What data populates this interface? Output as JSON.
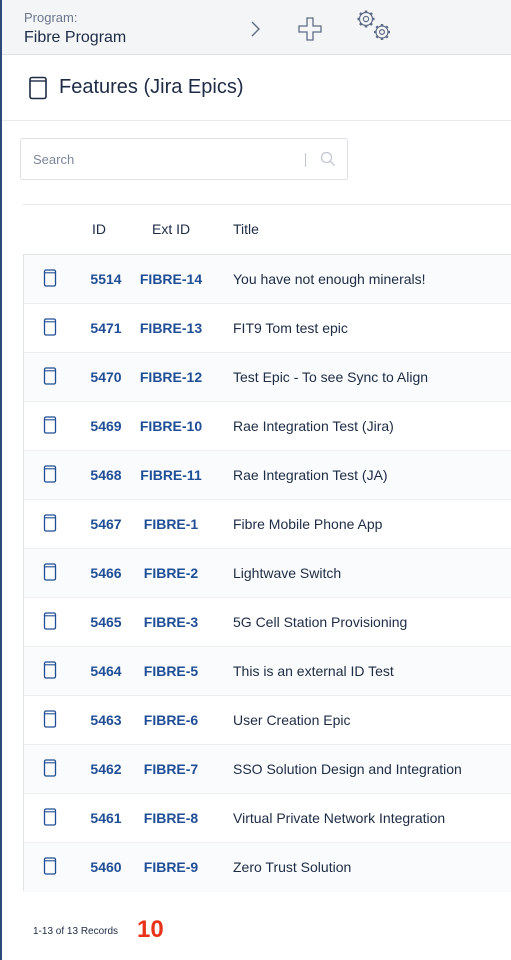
{
  "program": {
    "label": "Program:",
    "name": "Fibre Program"
  },
  "toolbar": {
    "icons": [
      "chevron-right-icon",
      "plus-icon",
      "gears-icon"
    ]
  },
  "header": {
    "title": "Features (Jira Epics)"
  },
  "search": {
    "placeholder": "Search",
    "value": ""
  },
  "table": {
    "columns": {
      "id": "ID",
      "ext_id": "Ext ID",
      "title": "Title"
    },
    "rows": [
      {
        "id": "5514",
        "ext_id": "FIBRE-14",
        "title": "You have not enough minerals!"
      },
      {
        "id": "5471",
        "ext_id": "FIBRE-13",
        "title": "FIT9 Tom test epic"
      },
      {
        "id": "5470",
        "ext_id": "FIBRE-12",
        "title": "Test Epic - To see Sync to Align"
      },
      {
        "id": "5469",
        "ext_id": "FIBRE-10",
        "title": "Rae Integration Test (Jira)"
      },
      {
        "id": "5468",
        "ext_id": "FIBRE-11",
        "title": "Rae Integration Test (JA)"
      },
      {
        "id": "5467",
        "ext_id": "FIBRE-1",
        "title": "Fibre Mobile Phone App"
      },
      {
        "id": "5466",
        "ext_id": "FIBRE-2",
        "title": "Lightwave Switch"
      },
      {
        "id": "5465",
        "ext_id": "FIBRE-3",
        "title": "5G Cell Station Provisioning"
      },
      {
        "id": "5464",
        "ext_id": "FIBRE-5",
        "title": "This is an external ID Test"
      },
      {
        "id": "5463",
        "ext_id": "FIBRE-6",
        "title": "User Creation Epic"
      },
      {
        "id": "5462",
        "ext_id": "FIBRE-7",
        "title": "SSO Solution Design and Integration"
      },
      {
        "id": "5461",
        "ext_id": "FIBRE-8",
        "title": "Virtual Private Network Integration"
      },
      {
        "id": "5460",
        "ext_id": "FIBRE-9",
        "title": "Zero Trust Solution"
      }
    ]
  },
  "footer": {
    "records": "1-13 of 13 Records",
    "page_size": "10"
  },
  "colors": {
    "link": "#1f4e96",
    "text": "#1d2b45",
    "accent": "#e8321a",
    "topbar_bg": "#f4f5f7"
  }
}
